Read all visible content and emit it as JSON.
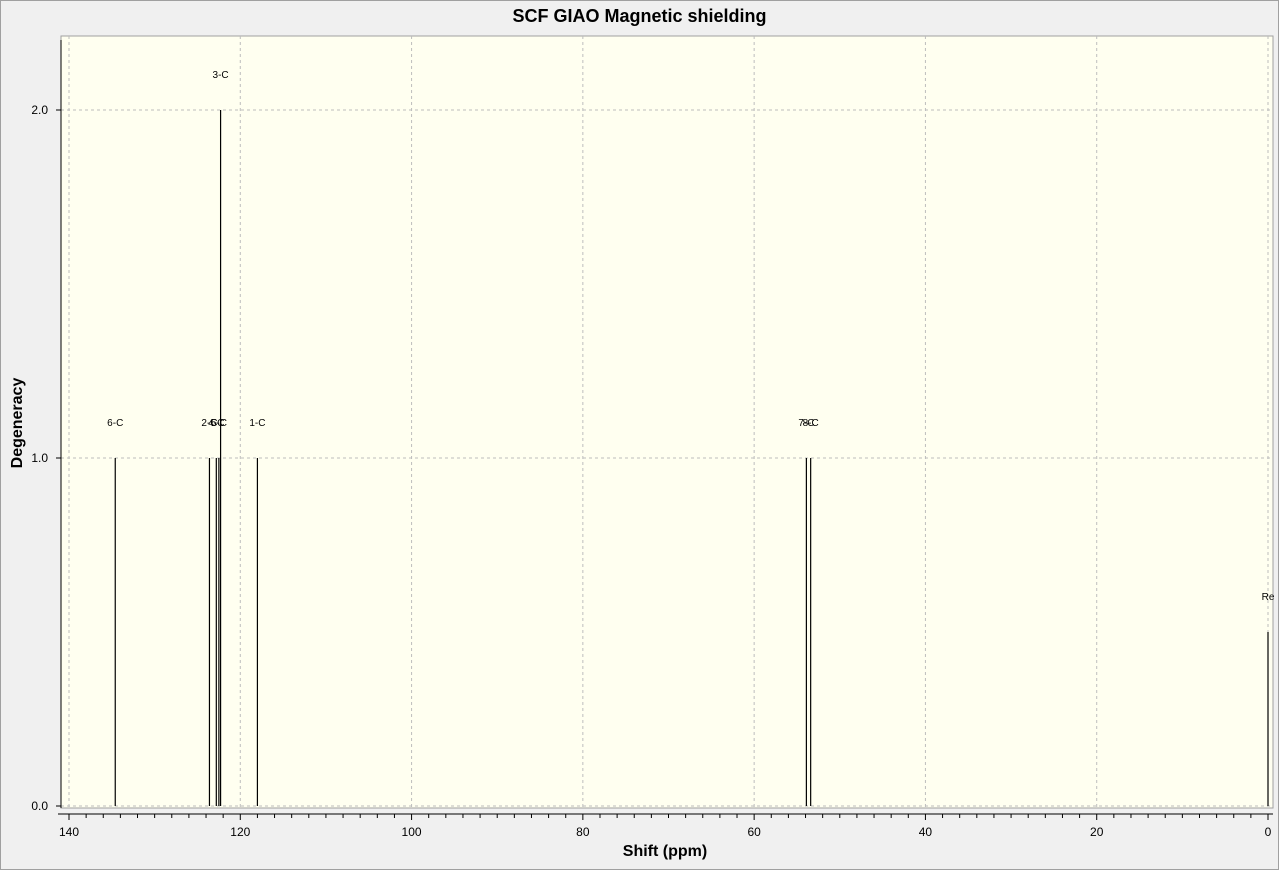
{
  "chart_data": {
    "type": "bar",
    "title": "SCF GIAO Magnetic shielding",
    "xlabel": "Shift (ppm)",
    "ylabel": "Degeneracy",
    "xlim": [
      140,
      0
    ],
    "ylim": [
      0,
      2.2
    ],
    "x_ticks": [
      "140",
      "120",
      "100",
      "80",
      "60",
      "40",
      "20",
      "0"
    ],
    "y_ticks": [
      "0.0",
      "1.0",
      "2.0"
    ],
    "grid": true,
    "peaks": [
      {
        "x": 134.6,
        "y": 1.0,
        "label": "6-C"
      },
      {
        "x": 123.6,
        "y": 1.0,
        "label": "2-C"
      },
      {
        "x": 122.8,
        "y": 1.0,
        "label": "4-C"
      },
      {
        "x": 122.5,
        "y": 1.0,
        "label": "5-C"
      },
      {
        "x": 122.3,
        "y": 2.0,
        "label": "3-C"
      },
      {
        "x": 118.0,
        "y": 1.0,
        "label": "1-C"
      },
      {
        "x": 53.9,
        "y": 1.0,
        "label": "7-C"
      },
      {
        "x": 53.4,
        "y": 1.0,
        "label": "8-C"
      },
      {
        "x": 0.0,
        "y": 0.5,
        "label": "Re"
      }
    ]
  },
  "colors": {
    "plot_background": "#fffff0",
    "grid": "#bdbdbd",
    "axis": "#000000",
    "window_background": "#f0f0f0"
  }
}
